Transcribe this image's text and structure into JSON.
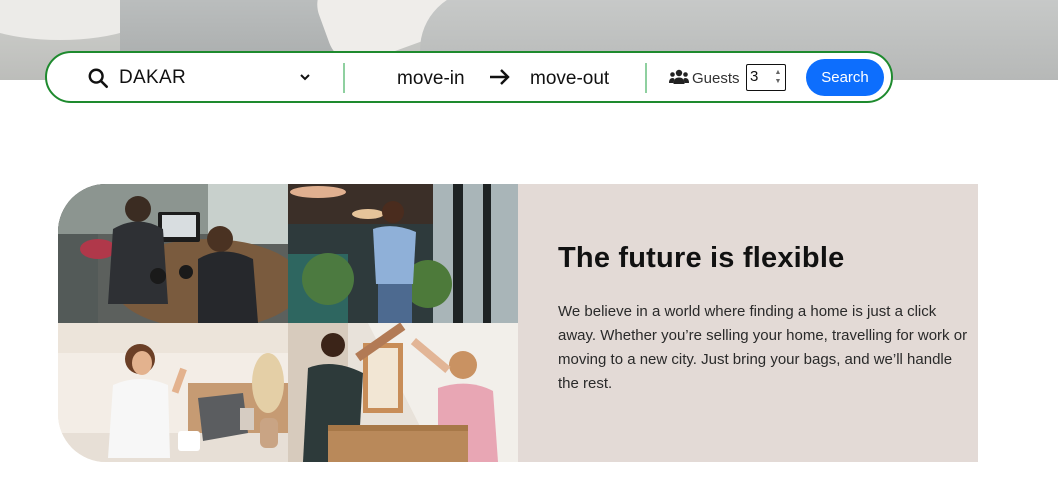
{
  "search": {
    "city": "DAKAR",
    "move_in": "move-in",
    "move_out": "move-out",
    "guests_label": "Guests",
    "guests_value": "3",
    "search_button": "Search"
  },
  "feature": {
    "title": "The future is flexible",
    "body": "We believe in a world where finding a home is just a click away. Whether you’re selling your home, travelling for work or moving to a new city. Just bring your bags, and we’ll handle the rest."
  },
  "colors": {
    "searchbar_border": "#1e8a2e",
    "divider": "#8fd0a0",
    "search_button_bg": "#0d6efd",
    "feature_panel_bg": "#e3dad6"
  },
  "icons": [
    "search-icon",
    "chevron-down-icon",
    "arrow-right-icon",
    "users-icon"
  ]
}
